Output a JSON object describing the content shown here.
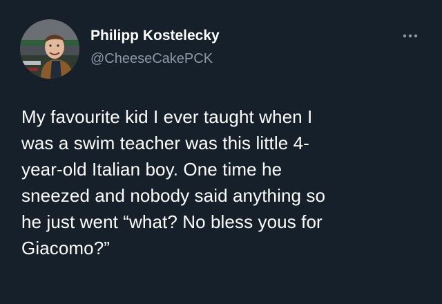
{
  "author": {
    "name": "Philipp Kostelecky",
    "handle": "@CheeseCakePCK",
    "avatar_icon": "profile-photo"
  },
  "menu": {
    "icon": "more-options-icon"
  },
  "tweet": {
    "lines": [
      "My favourite kid I ever taught when I",
      "was a swim teacher was this little 4-",
      "year-old Italian boy. One time he",
      "sneezed and nobody said anything so",
      "he just went “what? No bless yous for",
      "Giacomo?”"
    ]
  },
  "colors": {
    "background": "#15202b",
    "primary_text": "#ffffff",
    "secondary_text": "#8b98a5"
  }
}
